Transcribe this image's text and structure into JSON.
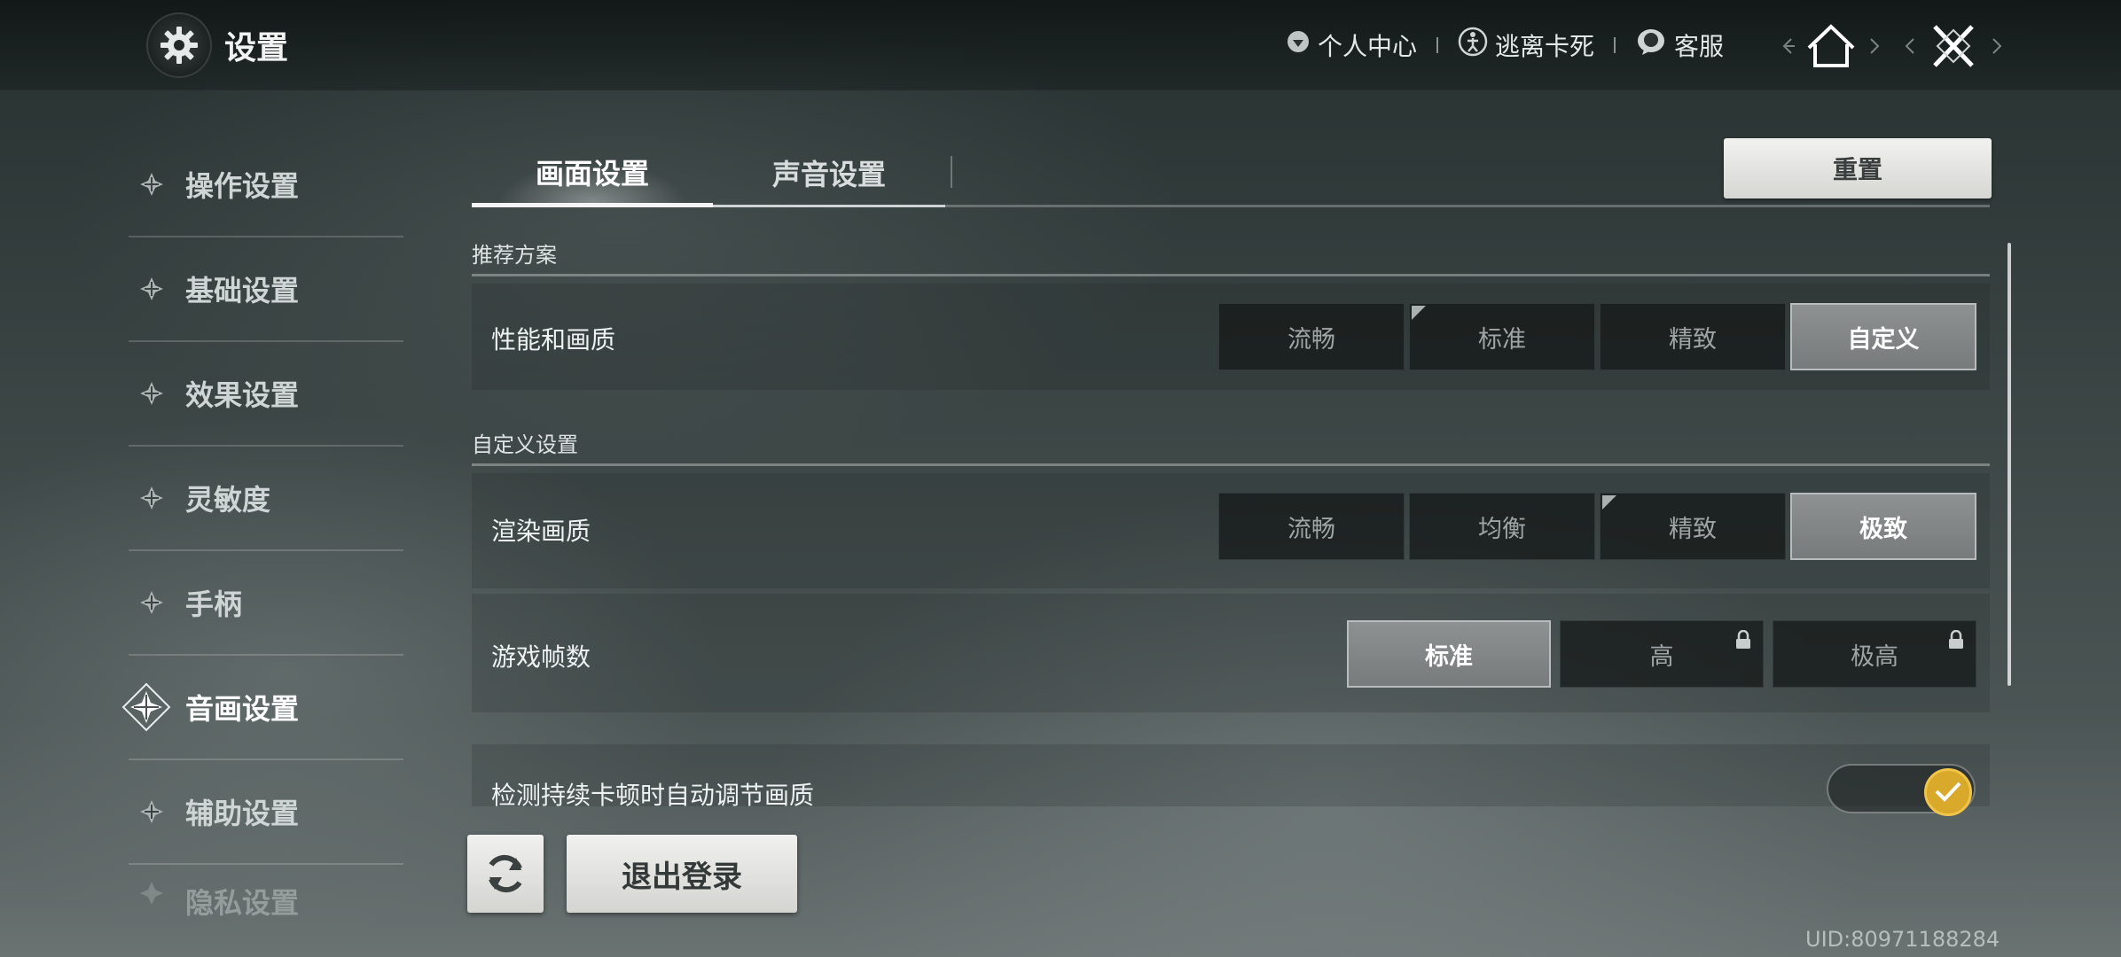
{
  "header": {
    "title": "设置",
    "title_icon": "gear-icon",
    "links": [
      {
        "label": "个人中心",
        "icon": "profile-icon"
      },
      {
        "label": "逃离卡死",
        "icon": "escape-icon"
      },
      {
        "label": "客服",
        "icon": "support-icon"
      }
    ]
  },
  "sidebar": {
    "items": [
      {
        "label": "操作设置"
      },
      {
        "label": "基础设置"
      },
      {
        "label": "效果设置"
      },
      {
        "label": "灵敏度"
      },
      {
        "label": "手柄"
      },
      {
        "label": "音画设置",
        "active": true
      },
      {
        "label": "辅助设置"
      },
      {
        "label": "隐私设置"
      }
    ]
  },
  "tabs": [
    {
      "label": "画面设置",
      "active": true
    },
    {
      "label": "声音设置"
    }
  ],
  "reset_label": "重置",
  "sections": {
    "recommended": "推荐方案",
    "custom": "自定义设置"
  },
  "rows": {
    "quality": {
      "label": "性能和画质",
      "options": [
        "流畅",
        "标准",
        "精致",
        "自定义"
      ],
      "selected": "自定义"
    },
    "render": {
      "label": "渲染画质",
      "options": [
        "流畅",
        "均衡",
        "精致",
        "极致"
      ],
      "selected": "极致"
    },
    "fps": {
      "label": "游戏帧数",
      "options": [
        "标准",
        "高",
        "极高"
      ],
      "selected": "标准"
    },
    "auto_adjust": {
      "label": "检测持续卡顿时自动调节画质",
      "enabled": true
    }
  },
  "footer": {
    "logout_label": "退出登录",
    "uid": "UID:80971188284"
  },
  "colors": {
    "accent_toggle": "#d8a92a",
    "selected_option": "#828686"
  }
}
